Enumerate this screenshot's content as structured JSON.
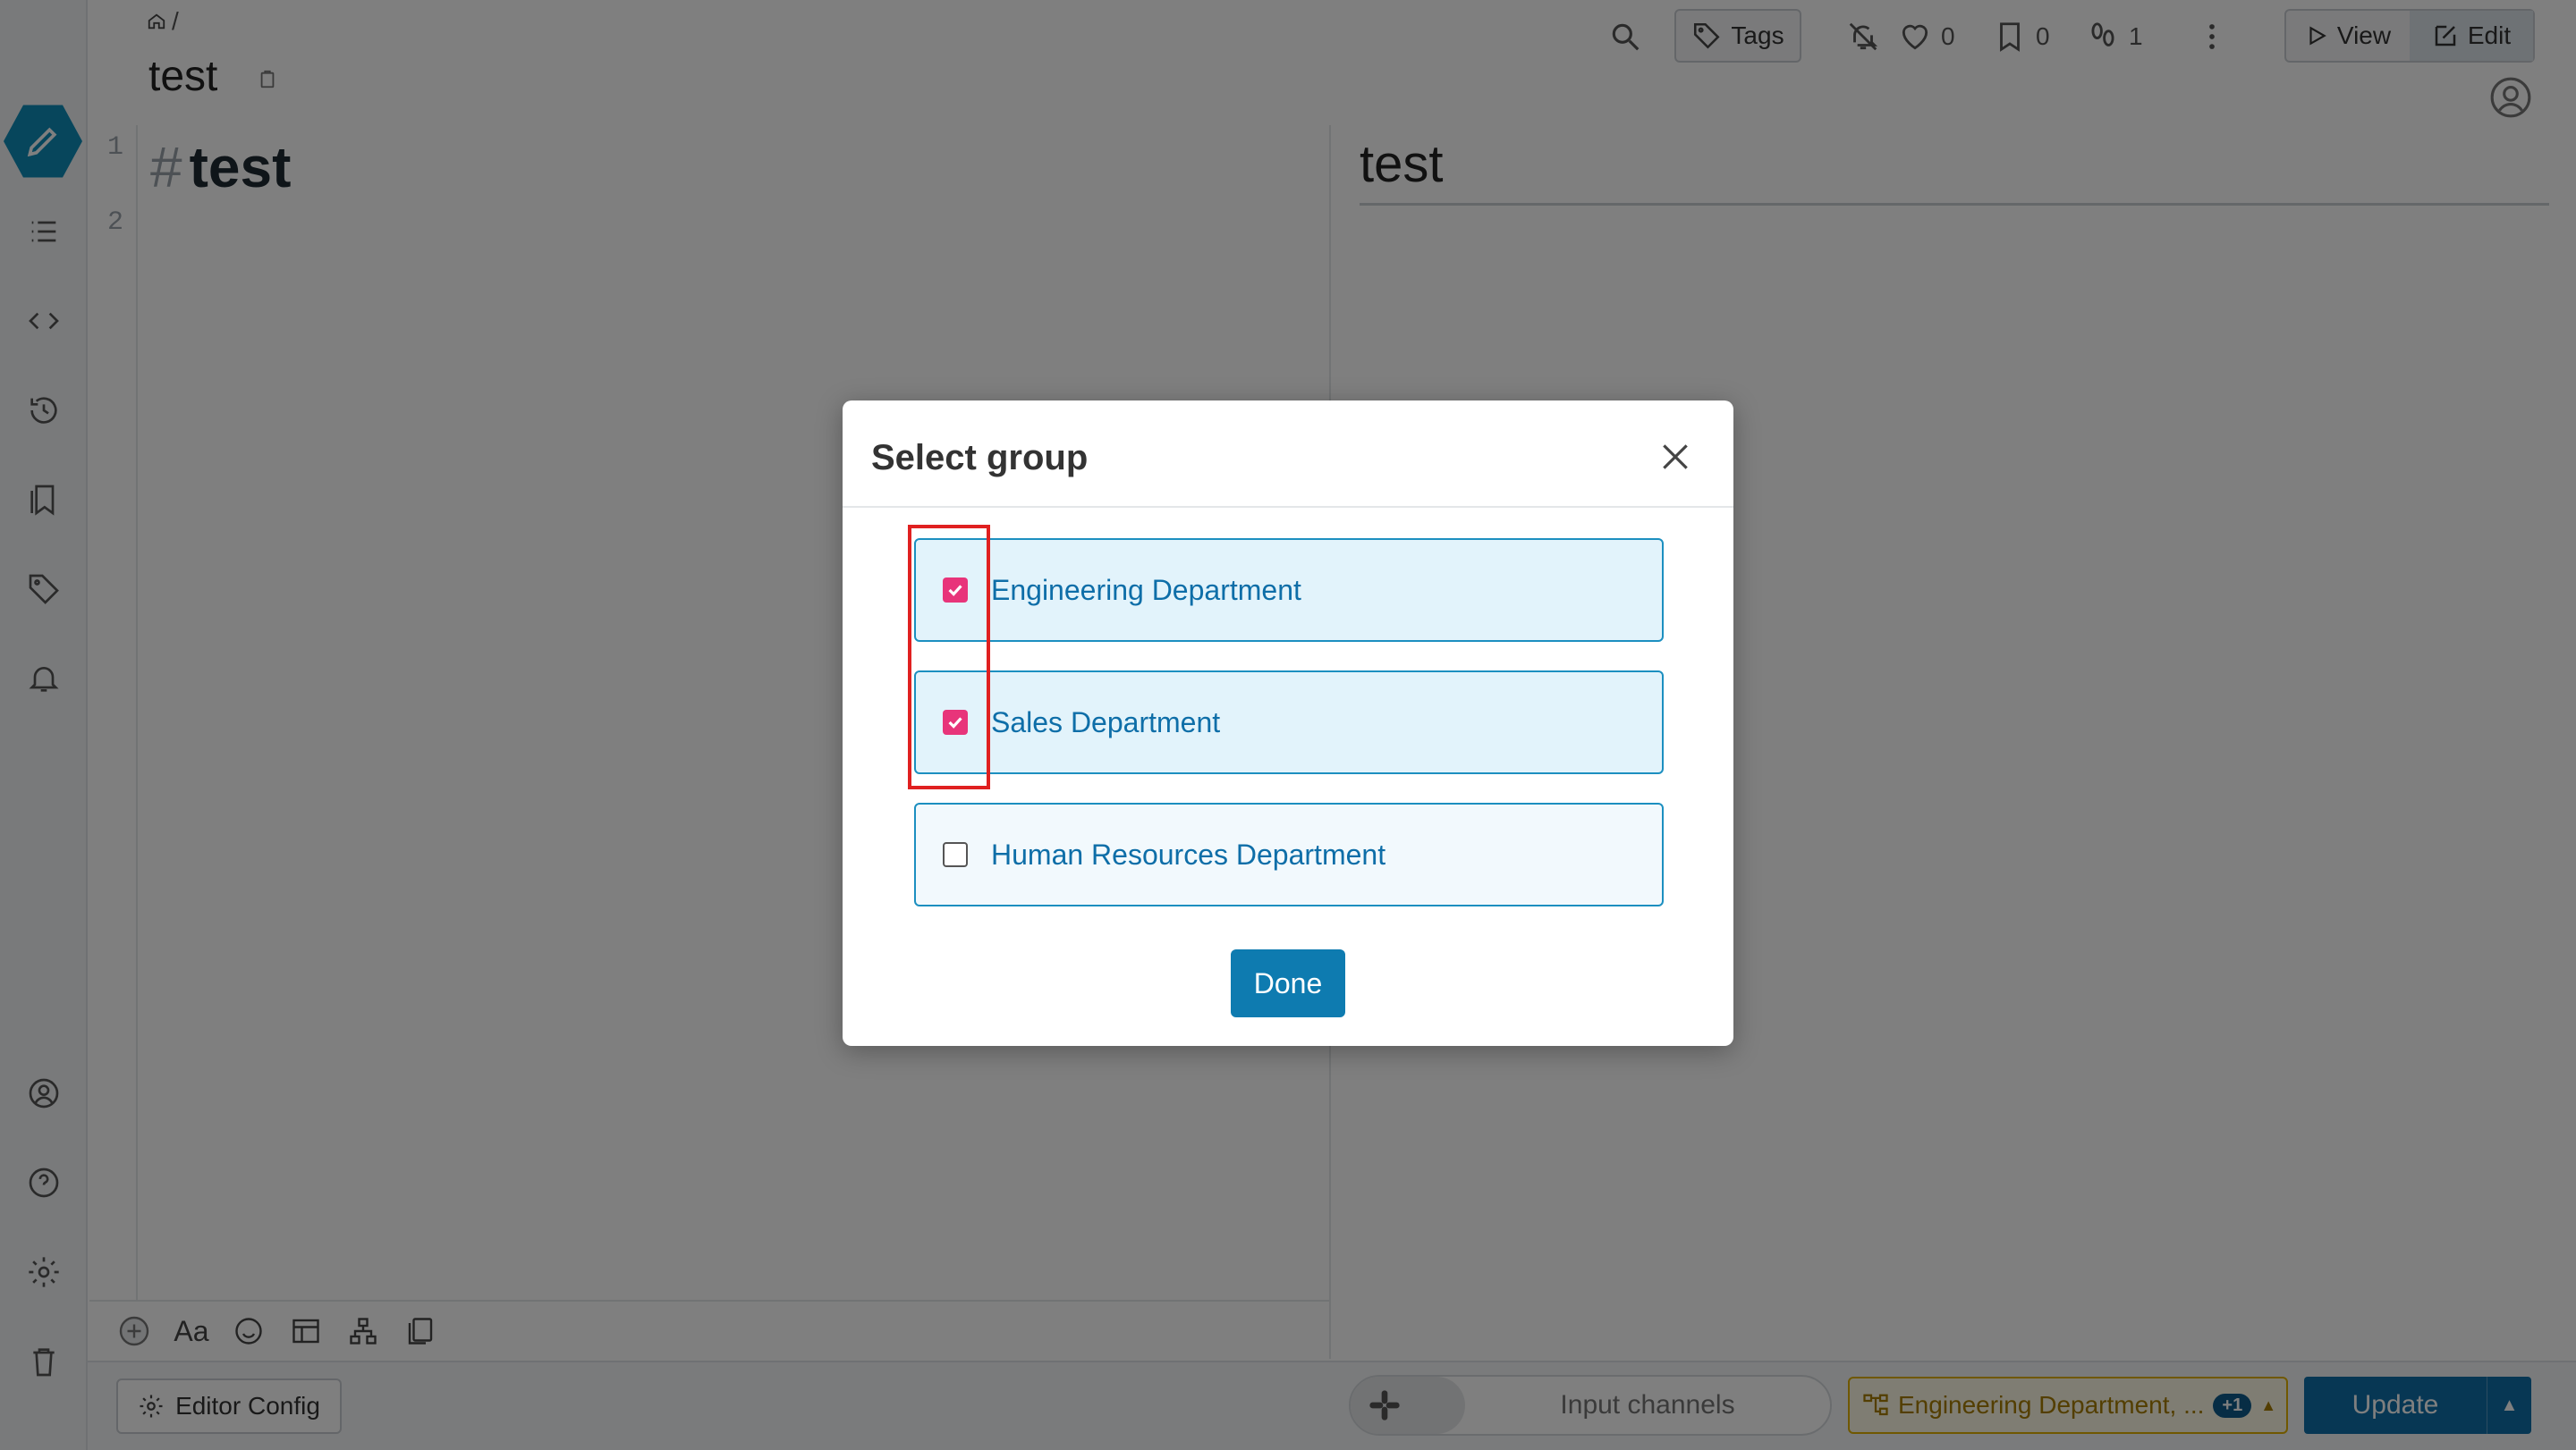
{
  "header": {
    "breadcrumb_sep": "/",
    "page_title": "test",
    "tags_label": "Tags",
    "like_count": "0",
    "bookmark_count": "0",
    "seen_count": "1",
    "view_label": "View",
    "edit_label": "Edit"
  },
  "editor": {
    "line_numbers": [
      "1",
      "2"
    ],
    "heading_hash": "#",
    "heading_text": "test",
    "toolbar_font_label": "Aa"
  },
  "preview": {
    "heading": "test"
  },
  "footer": {
    "editor_config_label": "Editor Config",
    "slack_placeholder": "Input channels",
    "grant_label": "Engineering Department, ...",
    "grant_extra_count": "+1",
    "update_label": "Update"
  },
  "modal": {
    "title": "Select group",
    "groups": [
      {
        "label": "Engineering Department",
        "checked": true
      },
      {
        "label": "Sales Department",
        "checked": true
      },
      {
        "label": "Human Resources Department",
        "checked": false
      }
    ],
    "done_label": "Done"
  },
  "colors": {
    "accent": "#0e7bb0",
    "checkbox_checked": "#e8347a",
    "highlight": "#e02020",
    "grant_border": "#e0b000"
  }
}
